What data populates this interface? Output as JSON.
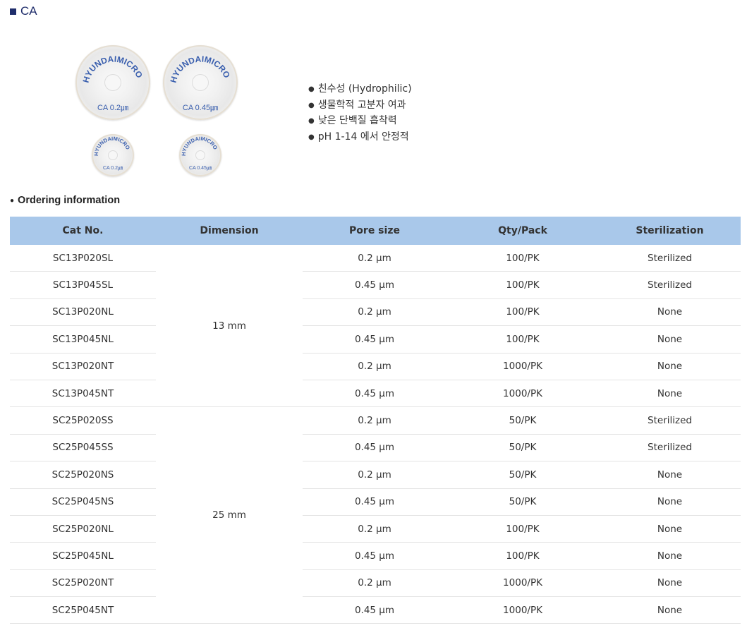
{
  "section": {
    "title": "CA"
  },
  "filters": [
    {
      "brand": "HYUNDAIMICRO",
      "spec": "CA  0.2㎛"
    },
    {
      "brand": "HYUNDAIMICRO",
      "spec": "CA  0.45㎛"
    },
    {
      "brand": "HYUNDAIMICRO",
      "spec": "CA  0.2㎛"
    },
    {
      "brand": "HYUNDAIMICRO",
      "spec": "CA  0.45㎛"
    }
  ],
  "features": [
    "친수성 (Hydrophilic)",
    "생물학적 고분자 여과",
    "낮은 단백질 흡착력",
    "pH 1-14 에서 안정적"
  ],
  "ordering": {
    "title": "Ordering information",
    "headers": [
      "Cat No.",
      "Dimension",
      "Pore size",
      "Qty/Pack",
      "Sterilization"
    ],
    "groups": [
      {
        "dimension": "13 mm",
        "rows": [
          [
            "SC13P020SL",
            "0.2 μm",
            "100/PK",
            "Sterilized"
          ],
          [
            "SC13P045SL",
            "0.45 μm",
            "100/PK",
            "Sterilized"
          ],
          [
            "SC13P020NL",
            "0.2 μm",
            "100/PK",
            "None"
          ],
          [
            "SC13P045NL",
            "0.45 μm",
            "100/PK",
            "None"
          ],
          [
            "SC13P020NT",
            "0.2 μm",
            "1000/PK",
            "None"
          ],
          [
            "SC13P045NT",
            "0.45 μm",
            "1000/PK",
            "None"
          ]
        ]
      },
      {
        "dimension": "25 mm",
        "rows": [
          [
            "SC25P020SS",
            "0.2 μm",
            "50/PK",
            "Sterilized"
          ],
          [
            "SC25P045SS",
            "0.45 μm",
            "50/PK",
            "Sterilized"
          ],
          [
            "SC25P020NS",
            "0.2 μm",
            "50/PK",
            "None"
          ],
          [
            "SC25P045NS",
            "0.45 μm",
            "50/PK",
            "None"
          ],
          [
            "SC25P020NL",
            "0.2 μm",
            "100/PK",
            "None"
          ],
          [
            "SC25P045NL",
            "0.45 μm",
            "100/PK",
            "None"
          ],
          [
            "SC25P020NT",
            "0.2 μm",
            "1000/PK",
            "None"
          ],
          [
            "SC25P045NT",
            "0.45 μm",
            "1000/PK",
            "None"
          ]
        ]
      }
    ]
  },
  "colors": {
    "header_bg": "#a9c8ea",
    "title_color": "#1f2d6b",
    "print_blue": "#3a5fae"
  }
}
